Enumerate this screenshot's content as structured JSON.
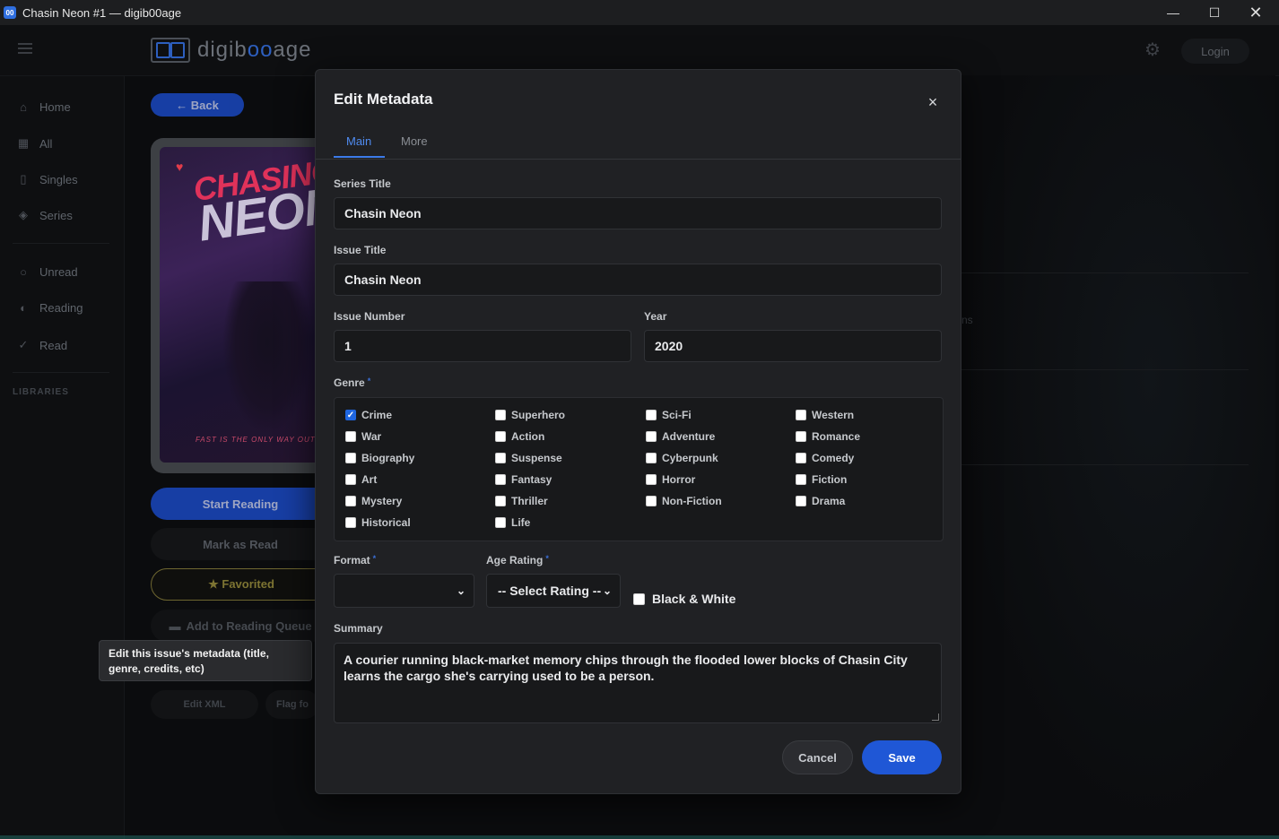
{
  "window": {
    "title": "Chasin Neon #1 — digib00age",
    "app_icon": "00"
  },
  "header": {
    "logo_text_a": "digib",
    "logo_text_b": "oo",
    "logo_text_c": "age",
    "login_label": "Login"
  },
  "sidebar": {
    "items": [
      {
        "label": "Home",
        "icon": "home-icon"
      },
      {
        "label": "All",
        "icon": "grid-icon"
      },
      {
        "label": "Singles",
        "icon": "book-icon"
      },
      {
        "label": "Series",
        "icon": "layers-icon"
      },
      {
        "label": "Unread",
        "icon": "circle-icon"
      },
      {
        "label": "Reading",
        "icon": "half-circle-icon"
      },
      {
        "label": "Read",
        "icon": "check-icon"
      }
    ],
    "libraries_label": "LIBRARIES"
  },
  "detail": {
    "back_label": "← Back",
    "cover": {
      "title_a": "CHASING",
      "title_b": "NEON",
      "tagline": "FAST IS THE ONLY WAY OUT"
    },
    "start_reading": "Start Reading",
    "mark_as_read": "Mark as Read",
    "favorited": "★ Favorited",
    "add_to_queue": "Add to Reading Queue",
    "tooltip": "Edit this issue's metadata (title, genre, credits, etc)",
    "edit_xml": "Edit XML",
    "flag": "Flag fo",
    "right_fragment": "ns"
  },
  "modal": {
    "title": "Edit Metadata",
    "close": "×",
    "tabs": [
      "Main",
      "More"
    ],
    "series_title": {
      "label": "Series Title",
      "value": "Chasin Neon"
    },
    "issue_title": {
      "label": "Issue Title",
      "value": "Chasin Neon"
    },
    "issue_number": {
      "label": "Issue Number",
      "value": "1"
    },
    "year": {
      "label": "Year",
      "value": "2020"
    },
    "genre": {
      "label": "Genre",
      "required_mark": "*",
      "options": [
        {
          "label": "Crime",
          "checked": true
        },
        {
          "label": "Superhero",
          "checked": false
        },
        {
          "label": "Sci-Fi",
          "checked": false
        },
        {
          "label": "Western",
          "checked": false
        },
        {
          "label": "War",
          "checked": false
        },
        {
          "label": "Action",
          "checked": false
        },
        {
          "label": "Adventure",
          "checked": false
        },
        {
          "label": "Romance",
          "checked": false
        },
        {
          "label": "Biography",
          "checked": false
        },
        {
          "label": "Suspense",
          "checked": false
        },
        {
          "label": "Cyberpunk",
          "checked": false
        },
        {
          "label": "Comedy",
          "checked": false
        },
        {
          "label": "Art",
          "checked": false
        },
        {
          "label": "Fantasy",
          "checked": false
        },
        {
          "label": "Horror",
          "checked": false
        },
        {
          "label": "Fiction",
          "checked": false
        },
        {
          "label": "Mystery",
          "checked": false
        },
        {
          "label": "Thriller",
          "checked": false
        },
        {
          "label": "Non-Fiction",
          "checked": false
        },
        {
          "label": "Drama",
          "checked": false
        },
        {
          "label": "Historical",
          "checked": false
        },
        {
          "label": "Life",
          "checked": false
        }
      ]
    },
    "format": {
      "label": "Format",
      "required_mark": "*",
      "value": ""
    },
    "age_rating": {
      "label": "Age Rating",
      "required_mark": "*",
      "value": "-- Select Rating --"
    },
    "black_white": {
      "label": "Black & White",
      "checked": false
    },
    "summary": {
      "label": "Summary",
      "value": "A courier running black-market memory chips through the flooded lower blocks of Chasin City learns the cargo she's carrying used to be a person."
    },
    "cancel_label": "Cancel",
    "save_label": "Save"
  },
  "colors": {
    "accent": "#1f57d6",
    "checkbox_checked": "#1f66e0",
    "favorite": "#7d7432"
  }
}
